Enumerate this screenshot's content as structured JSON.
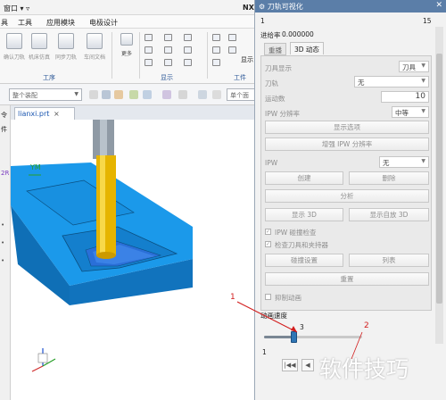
{
  "titlebar": {
    "window_label": "窗口 ▾ ▿",
    "app_label": "NX"
  },
  "menubar": {
    "items": [
      "具",
      "工具",
      "应用模块",
      "电极设计"
    ]
  },
  "ribbon": {
    "buttons": [
      "确认刀轨",
      "机床仿真",
      "同步刀轨",
      "车间文档"
    ],
    "more_label": "更多",
    "group_operation": "工序",
    "group_display": "显示",
    "group_workpiece": "工件",
    "display_short": "显示"
  },
  "filterbar": {
    "filter_value": "整个装配",
    "unit_hint": "单个面"
  },
  "navigator": {
    "strip_labels": [
      "令",
      "件",
      "",
      "2R"
    ]
  },
  "document": {
    "tab_label": "lianxi.prt",
    "wcs_label": "YM"
  },
  "dialog": {
    "title": "刀轨可视化",
    "tool_path_index": "1",
    "tool_path_index_right": "15",
    "feedrate_label": "进给率",
    "feedrate_value": "0.000000",
    "tabs": [
      "重播",
      "3D 动态"
    ],
    "tool_display_label": "刀具显示",
    "tool_display_value": "刀具",
    "tool_path_label": "刀轨",
    "tool_path_value": "无",
    "motion_count_label": "运动数",
    "motion_count_value": "10",
    "ipw_resolution_label": "IPW 分辨率",
    "ipw_resolution_value": "中等",
    "show_options_label": "显示选项",
    "increase_resolution_label": "增强 IPW 分辨率",
    "ipw_label": "IPW",
    "ipw_value": "无",
    "create_label": "创建",
    "delete_label": "删除",
    "analyze_label": "分析",
    "show_3d_label": "显示 3D",
    "show_self_3d_label": "显示自放 3D",
    "ipw_collision_label": "IPW 碰撞检查",
    "check_tool_holder_label": "检查刀具和夹持器",
    "collision_settings_label": "碰撞设置",
    "list_label": "列表",
    "reset_label": "重置",
    "suppress_anim_label": "抑制动画",
    "anim_speed_label": "动画速度",
    "speed_value": "3",
    "speed_level": 3,
    "speed_max": 10,
    "playback_index": "1"
  },
  "annotations": {
    "callout_1": "1",
    "callout_2": "2"
  },
  "watermark": "软件技巧",
  "colors": {
    "dialog_title_bg": "#5b7ea8",
    "part_blue": "#1793e0",
    "tool_yellow": "#e6b400",
    "annotation_red": "#d21c1c"
  }
}
